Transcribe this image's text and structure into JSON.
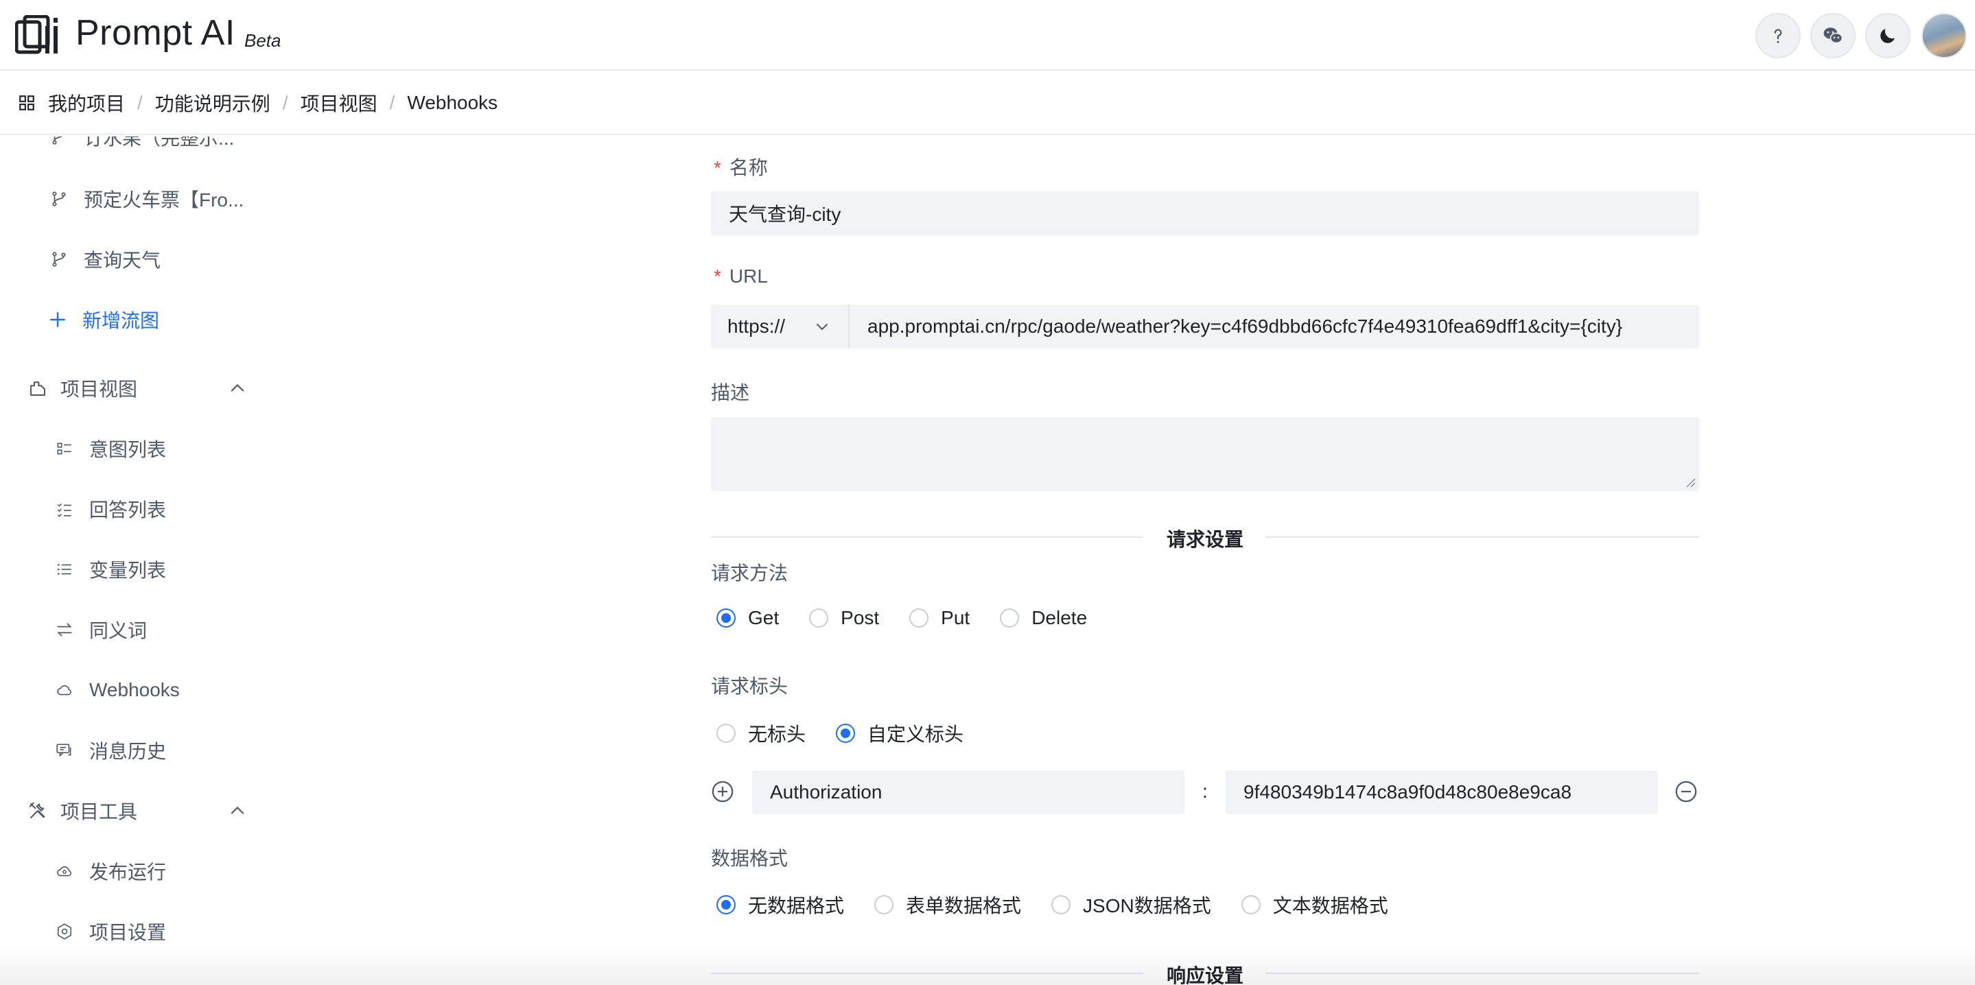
{
  "app": {
    "name": "Prompt AI",
    "badge": "Beta"
  },
  "header": {
    "icons": [
      "help-icon",
      "wechat-icon",
      "moon-icon"
    ]
  },
  "breadcrumb": [
    "我的项目",
    "功能说明示例",
    "项目视图",
    "Webhooks"
  ],
  "sidebar": {
    "flows": [
      {
        "label": "订水果（完整示...",
        "icon": "flow-branch-icon"
      },
      {
        "label": "预定火车票【Fro...",
        "icon": "flow-branch-icon"
      },
      {
        "label": "查询天气",
        "icon": "flow-branch-icon"
      }
    ],
    "add_flow": "新增流图",
    "project_view": {
      "title": "项目视图",
      "items": [
        {
          "label": "意图列表",
          "icon": "intent-list-icon"
        },
        {
          "label": "回答列表",
          "icon": "answer-list-icon"
        },
        {
          "label": "变量列表",
          "icon": "variable-list-icon"
        },
        {
          "label": "同义词",
          "icon": "synonym-icon"
        },
        {
          "label": "Webhooks",
          "icon": "cloud-icon"
        },
        {
          "label": "消息历史",
          "icon": "message-history-icon"
        }
      ]
    },
    "project_tools": {
      "title": "项目工具",
      "items": [
        {
          "label": "发布运行",
          "icon": "cloud-publish-icon"
        },
        {
          "label": "项目设置",
          "icon": "settings-icon"
        }
      ]
    }
  },
  "form": {
    "name": {
      "required_mark": "*",
      "label": "名称",
      "value": "天气查询-city"
    },
    "url": {
      "required_mark": "*",
      "label": "URL",
      "protocol": "https://",
      "value": "app.promptai.cn/rpc/gaode/weather?key=c4f69dbbd66cfc7f4e49310fea69dff1&city={city}"
    },
    "description": {
      "label": "描述",
      "value": ""
    },
    "request_section": "请求设置",
    "method": {
      "label": "请求方法",
      "options": [
        "Get",
        "Post",
        "Put",
        "Delete"
      ],
      "selected": "Get"
    },
    "headers": {
      "label": "请求标头",
      "options": [
        "无标头",
        "自定义标头"
      ],
      "selected": "自定义标头",
      "rows": [
        {
          "key": "Authorization",
          "separator": ":",
          "value": "9f480349b1474c8a9f0d48c80e8e9ca8"
        }
      ]
    },
    "data_format": {
      "label": "数据格式",
      "options": [
        "无数据格式",
        "表单数据格式",
        "JSON数据格式",
        "文本数据格式"
      ],
      "selected": "无数据格式"
    },
    "response_section": "响应设置"
  },
  "colors": {
    "accent": "#1f6df2",
    "required": "#f53f3f",
    "field_bg": "#f2f3f5"
  }
}
